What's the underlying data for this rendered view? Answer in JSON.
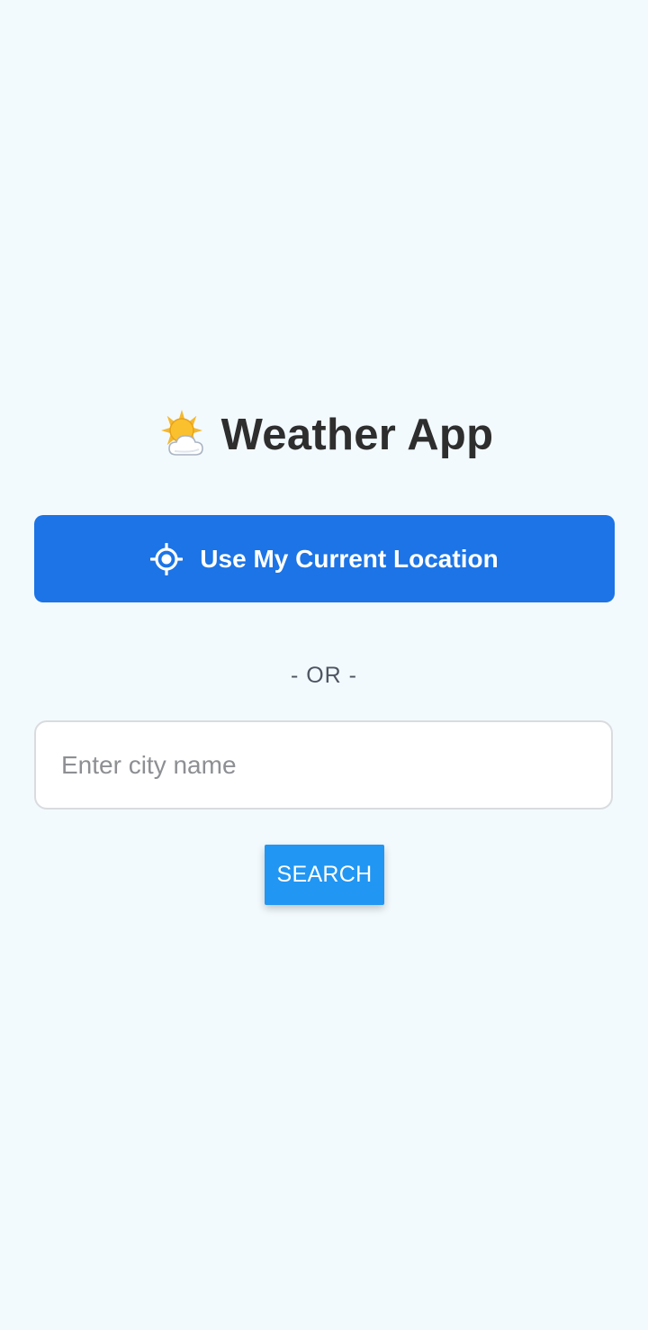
{
  "header": {
    "logo_icon": "sun-behind-cloud-icon",
    "title": "Weather App"
  },
  "location_button": {
    "icon": "target-icon",
    "label": "Use My Current Location",
    "color": "#1c74e6"
  },
  "divider": {
    "text": "- OR -"
  },
  "search": {
    "placeholder": "Enter city name",
    "value": "",
    "button_label": "SEARCH",
    "button_color": "#2196f3"
  },
  "theme": {
    "background": "#f3fafe",
    "title_color": "#2e2e2e"
  }
}
